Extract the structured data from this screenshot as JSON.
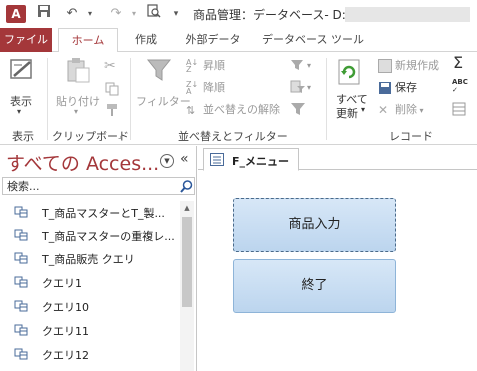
{
  "titlebar": {
    "app_icon": "A",
    "title": "商品管理：データベース- D:¥"
  },
  "ribbon_tabs": [
    "ファイル",
    "ホーム",
    "作成",
    "外部データ",
    "データベース ツール"
  ],
  "ribbon": {
    "view": {
      "button": "表示",
      "group": "表示"
    },
    "clipboard": {
      "paste": "貼り付け",
      "group": "クリップボード"
    },
    "sort_filter": {
      "filter": "フィルター",
      "ascending": "昇順",
      "descending": "降順",
      "clear_sort": "並べ替えの解除",
      "group": "並べ替えとフィルター"
    },
    "records": {
      "refresh": "すべて\n更新",
      "refresh_line1": "すべて",
      "refresh_line2": "更新",
      "new": "新規作成",
      "save": "保存",
      "delete": "削除",
      "group": "レコード"
    }
  },
  "navpane": {
    "title": "すべての Acces...",
    "search_placeholder": "検索...",
    "items": [
      "T_商品マスターとT_製...",
      "T_商品マスターの重複レ...",
      "T_商品販売 クエリ",
      "クエリ1",
      "クエリ10",
      "クエリ11",
      "クエリ12"
    ]
  },
  "document": {
    "tab": "F_メニュー",
    "buttons": [
      "商品入力",
      "終了"
    ]
  },
  "colors": {
    "accent": "#a4373a",
    "button_fill": "#c8ddf2",
    "button_border": "#8eb4d8"
  }
}
